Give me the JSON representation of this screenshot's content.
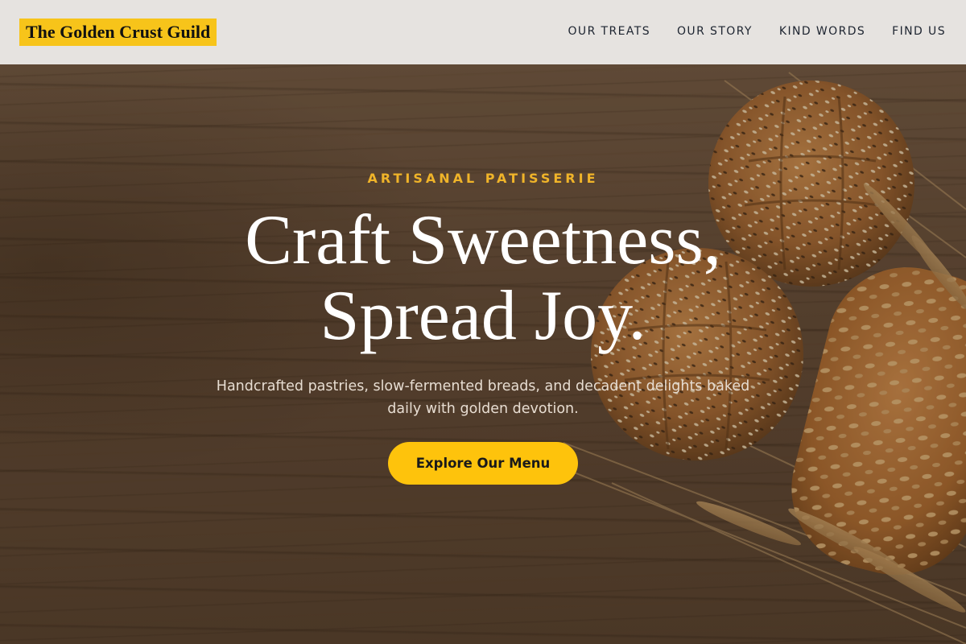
{
  "header": {
    "logo_text": "The Golden Crust Guild",
    "nav": [
      {
        "label": "OUR TREATS"
      },
      {
        "label": "OUR STORY"
      },
      {
        "label": "KIND WORDS"
      },
      {
        "label": "FIND US"
      }
    ]
  },
  "hero": {
    "eyebrow": "ARTISANAL PATISSERIE",
    "headline_line1": "Craft Sweetness,",
    "headline_line2": "Spread Joy.",
    "subtitle": "Handcrafted pastries, slow-fermented breads, and decadent delights baked daily with golden devotion.",
    "cta_label": "Explore Our Menu",
    "background_image": "bread-loaves-wheat-on-wood"
  },
  "colors": {
    "accent": "#fec30c",
    "logo_bg": "#f7c41a",
    "eyebrow": "#f0b429",
    "header_bg": "#e6e3e0",
    "nav_text": "#1d2430",
    "heading_text": "#ffffff"
  }
}
